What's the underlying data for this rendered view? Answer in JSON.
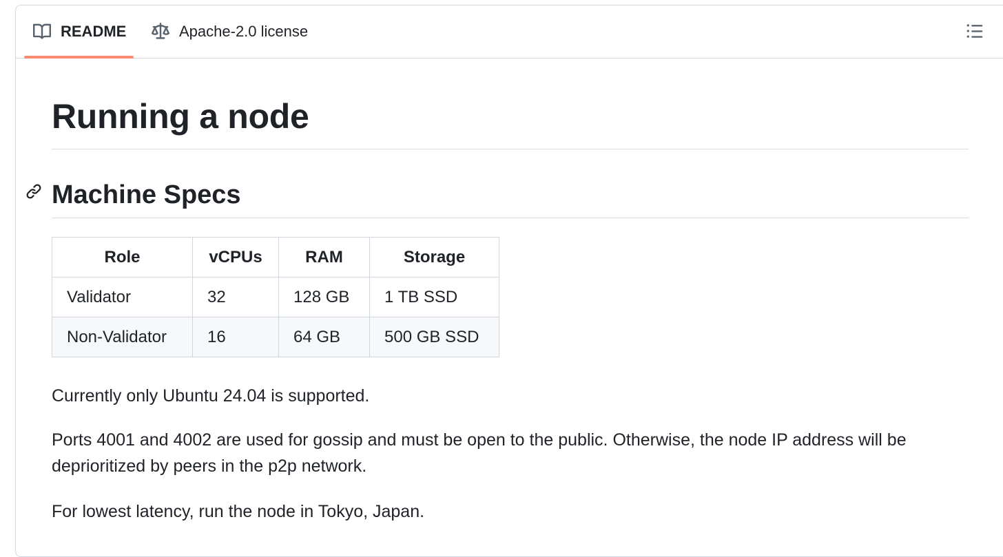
{
  "tabs": [
    {
      "label": "README",
      "icon": "book-icon",
      "active": true
    },
    {
      "label": "Apache-2.0 license",
      "icon": "law-icon",
      "active": false
    }
  ],
  "toolbar": {
    "outline_icon": "list-unordered-icon"
  },
  "colors": {
    "active_tab_underline": "#fd8c73",
    "text": "#1f2328",
    "border": "#d0d7de",
    "alt_row_bg": "#f6f8fa"
  },
  "readme": {
    "title": "Running a node",
    "section": {
      "anchor_icon": "link-icon",
      "title": "Machine Specs"
    },
    "table": {
      "headers": [
        "Role",
        "vCPUs",
        "RAM",
        "Storage"
      ],
      "rows": [
        [
          "Validator",
          "32",
          "128 GB",
          "1 TB SSD"
        ],
        [
          "Non-Validator",
          "16",
          "64 GB",
          "500 GB SSD"
        ]
      ]
    },
    "paragraphs": [
      "Currently only Ubuntu 24.04 is supported.",
      "Ports 4001 and 4002 are used for gossip and must be open to the public. Otherwise, the node IP address will be deprioritized by peers in the p2p network.",
      "For lowest latency, run the node in Tokyo, Japan."
    ]
  }
}
